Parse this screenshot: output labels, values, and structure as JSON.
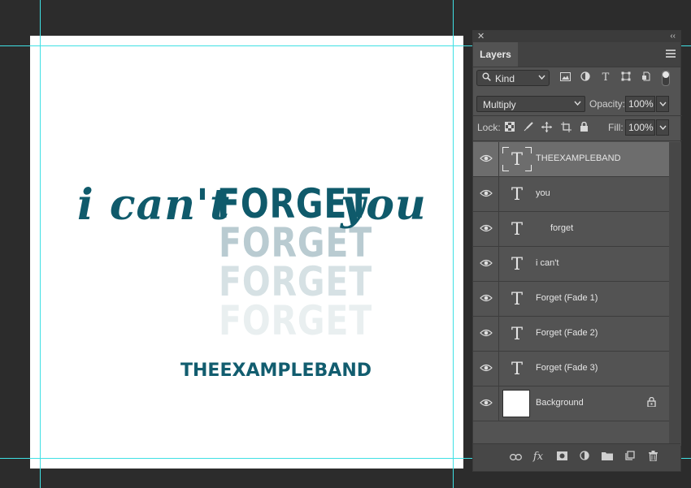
{
  "canvas": {
    "artwork": {
      "line1_left": "i can't",
      "line1_mid": "FORGET",
      "line1_right": "you",
      "fade_word": "FORGET",
      "band_name": "THEEXAMPLEBAND",
      "colors": {
        "primary": "#0f5a6b",
        "fade1": "#b9cbd1",
        "fade2": "#d6e1e4",
        "fade3": "#e9eff0"
      }
    }
  },
  "panel": {
    "tab_label": "Layers",
    "close_glyph": "✕",
    "collapse_glyph": "‹‹",
    "filter": {
      "kind_label": "Kind",
      "icons": [
        "image-filter-icon",
        "adjustment-filter-icon",
        "type-filter-icon",
        "shape-filter-icon",
        "smart-object-filter-icon"
      ]
    },
    "blend_mode": "Multiply",
    "opacity_label": "Opacity:",
    "opacity_value": "100%",
    "lock_label": "Lock:",
    "fill_label": "Fill:",
    "fill_value": "100%",
    "layers": [
      {
        "name": "THEEXAMPLEBAND",
        "type": "text",
        "selected": true
      },
      {
        "name": "you",
        "type": "text",
        "selected": false
      },
      {
        "name": "forget",
        "type": "text",
        "selected": false
      },
      {
        "name": "i can't",
        "type": "text",
        "selected": false
      },
      {
        "name": "Forget (Fade 1)",
        "type": "text",
        "selected": false
      },
      {
        "name": "Forget (Fade 2)",
        "type": "text",
        "selected": false
      },
      {
        "name": "Forget (Fade 3)",
        "type": "text",
        "selected": false
      },
      {
        "name": "Background",
        "type": "image",
        "selected": false,
        "locked": true
      }
    ],
    "thumb_glyph": "T",
    "bottom_icons": [
      "link-layers-icon",
      "fx-icon",
      "mask-icon",
      "adjustment-layer-icon",
      "group-folder-icon",
      "new-layer-icon",
      "trash-icon"
    ],
    "fx_text": "fx"
  }
}
